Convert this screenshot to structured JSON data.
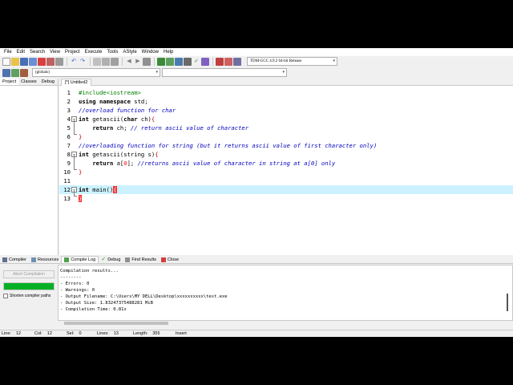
{
  "menu": [
    "File",
    "Edit",
    "Search",
    "View",
    "Project",
    "Execute",
    "Tools",
    "AStyle",
    "Window",
    "Help"
  ],
  "toolbar": {
    "compiler_select": "TDM-GCC 4.9.2 64-bit Release",
    "scope_select": "(globals)",
    "second_select": ""
  },
  "left_panel": {
    "tabs": [
      "Project",
      "Classes",
      "Debug"
    ]
  },
  "editor": {
    "tab_label": "[*] Untitled2",
    "lines": [
      {
        "num": "1",
        "parts": [
          [
            "pp",
            "#include<iostream>"
          ]
        ]
      },
      {
        "num": "2",
        "parts": [
          [
            "kw",
            "using namespace"
          ],
          [
            "",
            " std;"
          ]
        ]
      },
      {
        "num": "3",
        "parts": [
          [
            "cm",
            "//overload function for char"
          ]
        ]
      },
      {
        "num": "4",
        "parts": [
          [
            "kw",
            "int"
          ],
          [
            "",
            " getascii("
          ],
          [
            "kw",
            "char"
          ],
          [
            "",
            " ch)"
          ],
          [
            "br",
            "{"
          ]
        ]
      },
      {
        "num": "5",
        "parts": [
          [
            "",
            "    "
          ],
          [
            "kw",
            "return"
          ],
          [
            "",
            " ch; "
          ],
          [
            "cm",
            "// return ascii value of character"
          ]
        ]
      },
      {
        "num": "6",
        "parts": [
          [
            "br",
            "}"
          ]
        ]
      },
      {
        "num": "7",
        "parts": [
          [
            "cm",
            "//overloading function for string (but it returns ascii value of first character only)"
          ]
        ]
      },
      {
        "num": "8",
        "parts": [
          [
            "kw",
            "int"
          ],
          [
            "",
            " getascii(string s)"
          ],
          [
            "br",
            "{"
          ]
        ]
      },
      {
        "num": "9",
        "parts": [
          [
            "",
            "    "
          ],
          [
            "kw",
            "return"
          ],
          [
            "",
            " a["
          ],
          [
            "sym",
            "0"
          ],
          [
            "",
            "]; "
          ],
          [
            "cm",
            "//returns ascii value of character in string at a[0] only"
          ]
        ]
      },
      {
        "num": "10",
        "parts": [
          [
            "br",
            "}"
          ]
        ]
      },
      {
        "num": "11",
        "parts": []
      },
      {
        "num": "12",
        "parts": [
          [
            "kw",
            "int"
          ],
          [
            "",
            " main()"
          ],
          [
            "cursor",
            "{"
          ]
        ]
      },
      {
        "num": "13",
        "parts": [
          [
            "cursor",
            "}"
          ]
        ]
      }
    ]
  },
  "bottom_tabs": [
    "Compiler",
    "Resources",
    "Compile Log",
    "Debug",
    "Find Results",
    "Close"
  ],
  "compile": {
    "abort_label": "Abort Compilation",
    "progress": 1.0,
    "shorten_label": "Shorten compiler paths",
    "log": "Compilation results...\n--------\n- Errors: 0\n- Warnings: 0\n- Output Filename: C:\\Users\\MY DELL\\Desktop\\xxxxxxxxxx\\test.exe\n- Output Size: 1.83247375488281 MiB\n- Compilation Time: 0.81s"
  },
  "status": {
    "line_label": "Line:",
    "line_value": "12",
    "col_label": "Col:",
    "col_value": "12",
    "sel_label": "Sel:",
    "sel_value": "0",
    "lines_label": "Lines:",
    "lines_value": "13",
    "length_label": "Length:",
    "length_value": "355",
    "mode": "Insert"
  }
}
